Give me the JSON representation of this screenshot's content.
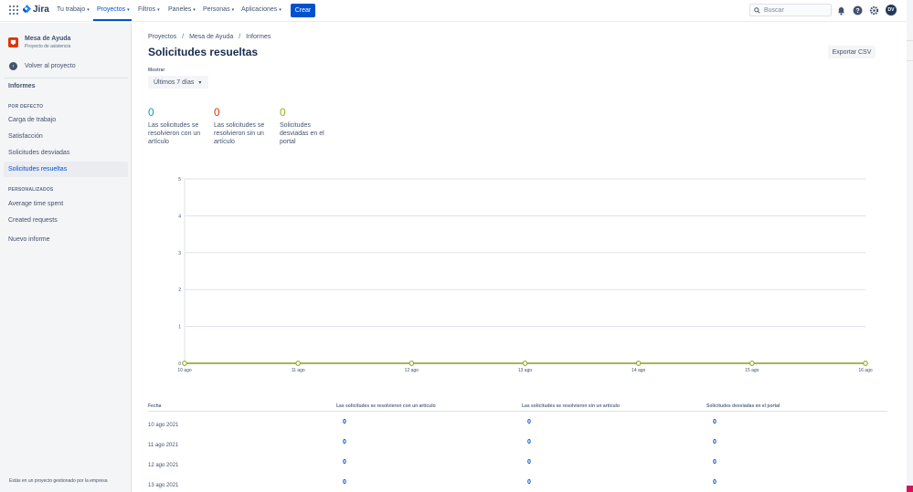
{
  "topnav": {
    "logo_text": "Jira",
    "items": [
      {
        "label": "Tu trabajo",
        "active": false
      },
      {
        "label": "Proyectos",
        "active": true
      },
      {
        "label": "Filtros",
        "active": false
      },
      {
        "label": "Paneles",
        "active": false
      },
      {
        "label": "Personas",
        "active": false
      },
      {
        "label": "Aplicaciones",
        "active": false
      }
    ],
    "create_label": "Crear",
    "search_placeholder": "Buscar",
    "avatar_initials": "DV",
    "icons": [
      "notifications-icon",
      "help-icon",
      "settings-icon"
    ]
  },
  "sidebar": {
    "project_name": "Mesa de Ayuda",
    "project_type": "Proyecto de asistencia",
    "back_label": "Volver al proyecto",
    "section_title": "Informes",
    "group_default": "POR DEFECTO",
    "default_items": [
      {
        "label": "Carga de trabajo",
        "active": false
      },
      {
        "label": "Satisfacción",
        "active": false
      },
      {
        "label": "Solicitudes desviadas",
        "active": false
      },
      {
        "label": "Solicitudes resueltas",
        "active": true
      }
    ],
    "group_custom": "PERSONALIZADOS",
    "custom_items": [
      {
        "label": "Average time spent"
      },
      {
        "label": "Created requests"
      }
    ],
    "new_report": "Nuevo informe",
    "footer": "Estás en un proyecto gestionado por la empresa"
  },
  "breadcrumbs": [
    "Proyectos",
    "Mesa de Ayuda",
    "Informes"
  ],
  "page_title": "Solicitudes resueltas",
  "export_label": "Exportar CSV",
  "show_label": "Mostrar",
  "show_value": "Últimos 7 días",
  "stats": [
    {
      "value": "0",
      "label": "Las solicitudes se resolvieron con un artículo",
      "color": "#00a3bf"
    },
    {
      "value": "0",
      "label": "Las solicitudes se resolvieron sin un artículo",
      "color": "#de350b"
    },
    {
      "value": "0",
      "label": "Solicitudes desviadas en el portal",
      "color": "#8fb31a"
    }
  ],
  "chart_data": {
    "type": "line",
    "x": [
      "10 ago",
      "11 ago",
      "12 ago",
      "13 ago",
      "14 ago",
      "15 ago",
      "16 ago"
    ],
    "y_ticks": [
      "0",
      "1",
      "2",
      "3",
      "4",
      "5"
    ],
    "ylim": [
      0,
      5
    ],
    "grid": true,
    "series": [
      {
        "values": [
          0,
          0,
          0,
          0,
          0,
          0,
          0
        ],
        "color": "#00a3bf"
      },
      {
        "values": [
          0,
          0,
          0,
          0,
          0,
          0,
          0
        ],
        "color": "#de350b"
      },
      {
        "values": [
          0,
          0,
          0,
          0,
          0,
          0,
          0
        ],
        "color": "#8fb31a"
      }
    ]
  },
  "table": {
    "headers": [
      "Fecha",
      "Las solicitudes se resolvieron con un artículo",
      "Las solicitudes se resolvieron sin un artículo",
      "Solicitudes desviadas en el portal"
    ],
    "rows": [
      [
        "10 ago 2021",
        "0",
        "0",
        "0"
      ],
      [
        "11 ago 2021",
        "0",
        "0",
        "0"
      ],
      [
        "12 ago 2021",
        "0",
        "0",
        "0"
      ],
      [
        "13 ago 2021",
        "0",
        "0",
        "0"
      ]
    ]
  }
}
